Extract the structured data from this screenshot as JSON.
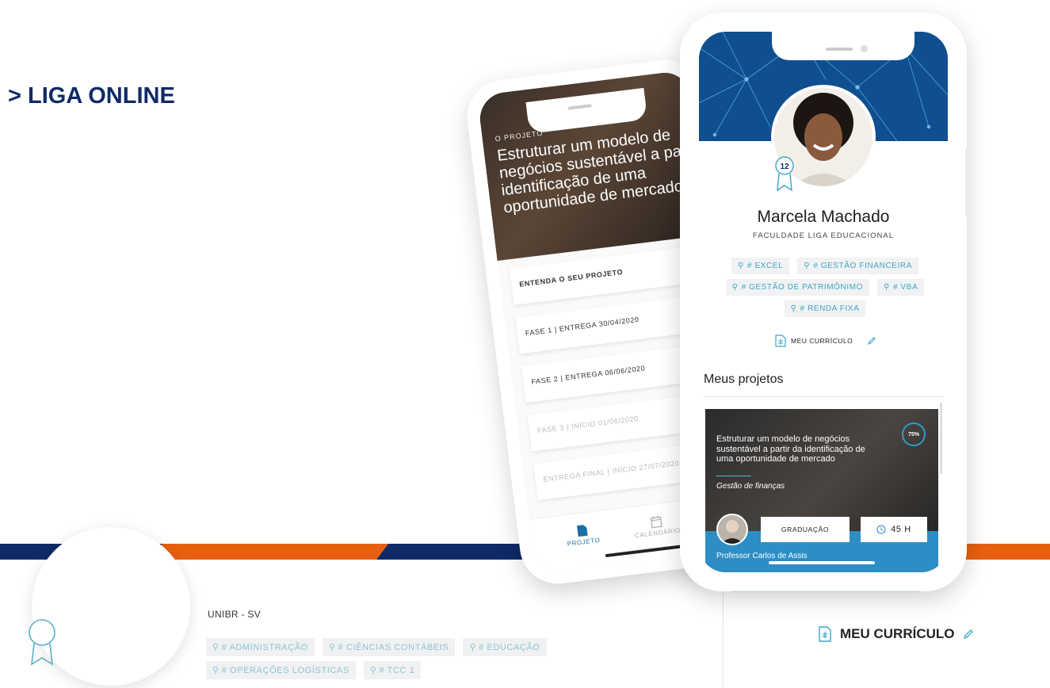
{
  "page": {
    "title": "> LIGA ONLINE"
  },
  "colors": {
    "navy": "#102a68",
    "orange": "#e8600f",
    "blue": "#2c8ec4",
    "tag_text": "#3ea6c4"
  },
  "back_phone": {
    "hero_kicker": "O PROJETO",
    "hero_title": "Estruturar um modelo de negócios sustentável a partir da identificação de uma oportunidade de mercado",
    "list": [
      {
        "label": "ENTENDA O SEU PROJETO",
        "dim": false
      },
      {
        "label": "FASE 1 | ENTREGA 30/04/2020",
        "dim": false
      },
      {
        "label": "FASE 2 | ENTREGA 06/06/2020",
        "dim": false
      },
      {
        "label": "FASE 3 | INÍCIO 01/06/2020",
        "dim": true
      },
      {
        "label": "ENTREGA FINAL | INÍCIO 27/07/2020",
        "dim": true
      }
    ],
    "nav": [
      {
        "label": "PROJETO",
        "icon": "document-icon",
        "active": true
      },
      {
        "label": "CALENDÁRIO",
        "icon": "calendar-icon",
        "active": false
      }
    ]
  },
  "front_phone": {
    "badge_level": "12",
    "name": "Marcela Machado",
    "institution": "FACULDADE LIGA EDUCACIONAL",
    "tags": [
      "# EXCEL",
      "# GESTÃO FINANCEIRA",
      "# GESTÃO DE PATRIMÔNIMO",
      "# VBA",
      "# RENDA FIXA"
    ],
    "curriculum_label": "MEU CURRÍCULO",
    "section_title": "Meus projetos",
    "project_card": {
      "title": "Estruturar um modelo de negócios sustentável a partir da identificação de uma oportunidade de mercado",
      "subtitle": "Gestão de finanças",
      "progress_label": "75%",
      "progress": 0.75,
      "level_chip": "GRADUAÇÃO",
      "hours_chip": "45 H",
      "teacher": "Professor Carlos de Assis"
    }
  },
  "background_profile": {
    "institution": "UNIBR - SV",
    "tags": [
      "# ADMINISTRAÇÃO",
      "# CIÊNCIAS CONTÁBEIS",
      "# EDUCAÇÃO",
      "# OPERAÇÕES LOGÍSTICAS",
      "# TCC 1"
    ],
    "curriculum_label": "MEU CURRÍCULO"
  }
}
